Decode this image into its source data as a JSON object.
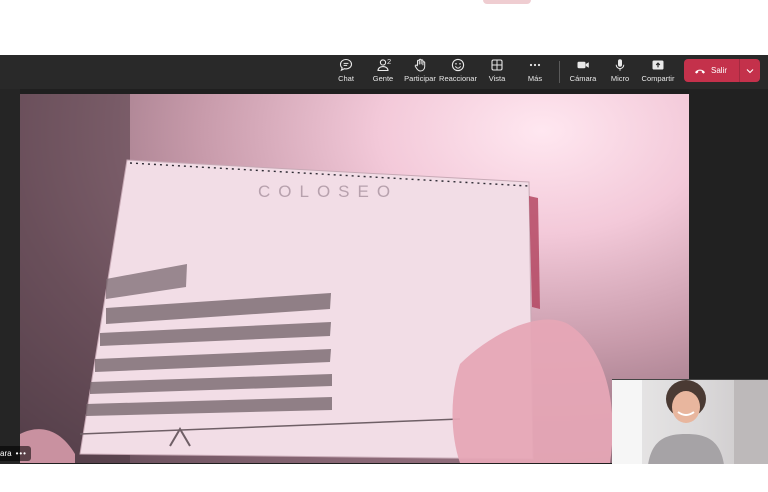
{
  "toolbar": {
    "items": [
      {
        "label": "Chat",
        "icon": "chat-icon"
      },
      {
        "label": "Gente",
        "icon": "people-icon",
        "count": "2"
      },
      {
        "label": "Participar",
        "icon": "raise-hand-icon"
      },
      {
        "label": "Reaccionar",
        "icon": "smiley-icon"
      },
      {
        "label": "Vista",
        "icon": "view-grid-icon"
      },
      {
        "label": "Más",
        "icon": "more-icon"
      },
      {
        "label": "Cámara",
        "icon": "camera-icon"
      },
      {
        "label": "Micro",
        "icon": "microphone-icon"
      },
      {
        "label": "Compartir",
        "icon": "share-icon"
      }
    ],
    "leave_label": "Salir",
    "leave_color": "#c4314b"
  },
  "video": {
    "notebook_title": "COLOSEO"
  },
  "participant": {
    "name_fragment": "ara",
    "more": "•••"
  },
  "colors": {
    "toolbar_bg": "#292929",
    "stage_bg": "#1f1f1f"
  }
}
